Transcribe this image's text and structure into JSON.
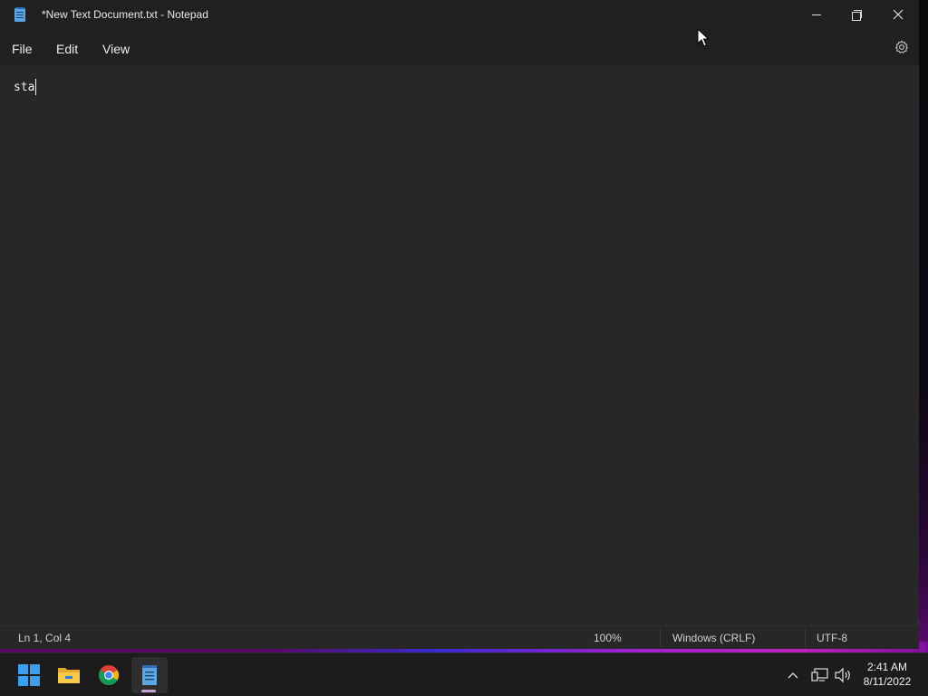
{
  "window": {
    "title": "*New Text Document.txt - Notepad"
  },
  "menu": {
    "file": "File",
    "edit": "Edit",
    "view": "View"
  },
  "editor": {
    "content": "sta"
  },
  "status": {
    "position": "Ln 1, Col 4",
    "zoom": "100%",
    "line_ending": "Windows (CRLF)",
    "encoding": "UTF-8"
  },
  "taskbar": {
    "apps": [
      {
        "name": "start-icon"
      },
      {
        "name": "file-explorer-icon"
      },
      {
        "name": "chrome-icon"
      },
      {
        "name": "notepad-icon",
        "active": true
      }
    ],
    "clock_time": "2:41 AM",
    "clock_date": "8/11/2022"
  },
  "colors": {
    "titlebar": "#202020",
    "editor_bg": "#272727",
    "accent": "#3aa0ef"
  }
}
